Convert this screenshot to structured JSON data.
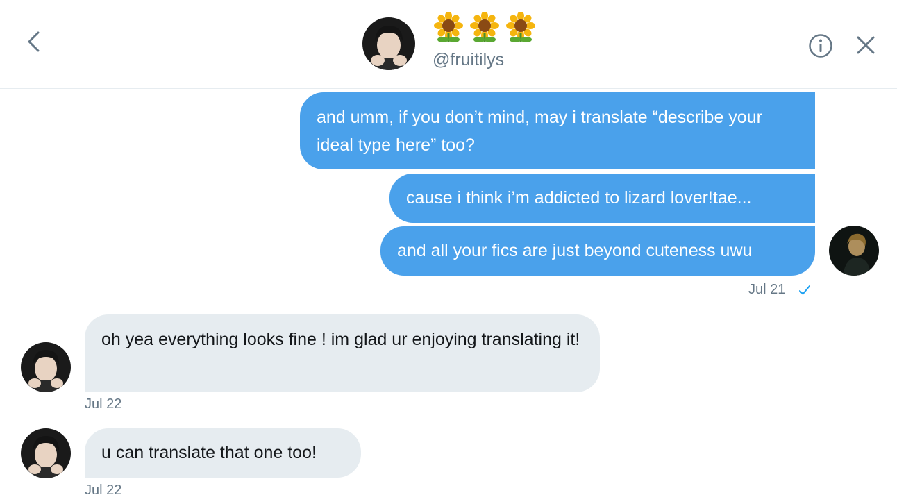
{
  "header": {
    "display_name_emojis": [
      "sunflower-icon",
      "sunflower-icon",
      "sunflower-icon"
    ],
    "handle": "@fruitilys"
  },
  "messages": {
    "sent": [
      {
        "text": "and umm, if you don’t mind, may i translate “describe your ideal type here” too?"
      },
      {
        "text": "cause i think i’m addicted to lizard lover!tae..."
      },
      {
        "text": "and all your fics are just beyond cuteness uwu"
      }
    ],
    "sent_timestamp": "Jul 21",
    "received": [
      {
        "text": "oh yea everything looks fine !  im glad ur enjoying translating it!",
        "timestamp": "Jul 22"
      },
      {
        "text": "u can translate that one too!",
        "timestamp": "Jul 22"
      }
    ]
  },
  "colors": {
    "sent_bubble": "#4aa1eb",
    "received_bubble": "#e6ecf0",
    "accent": "#1da1f2",
    "muted_text": "#657786"
  }
}
